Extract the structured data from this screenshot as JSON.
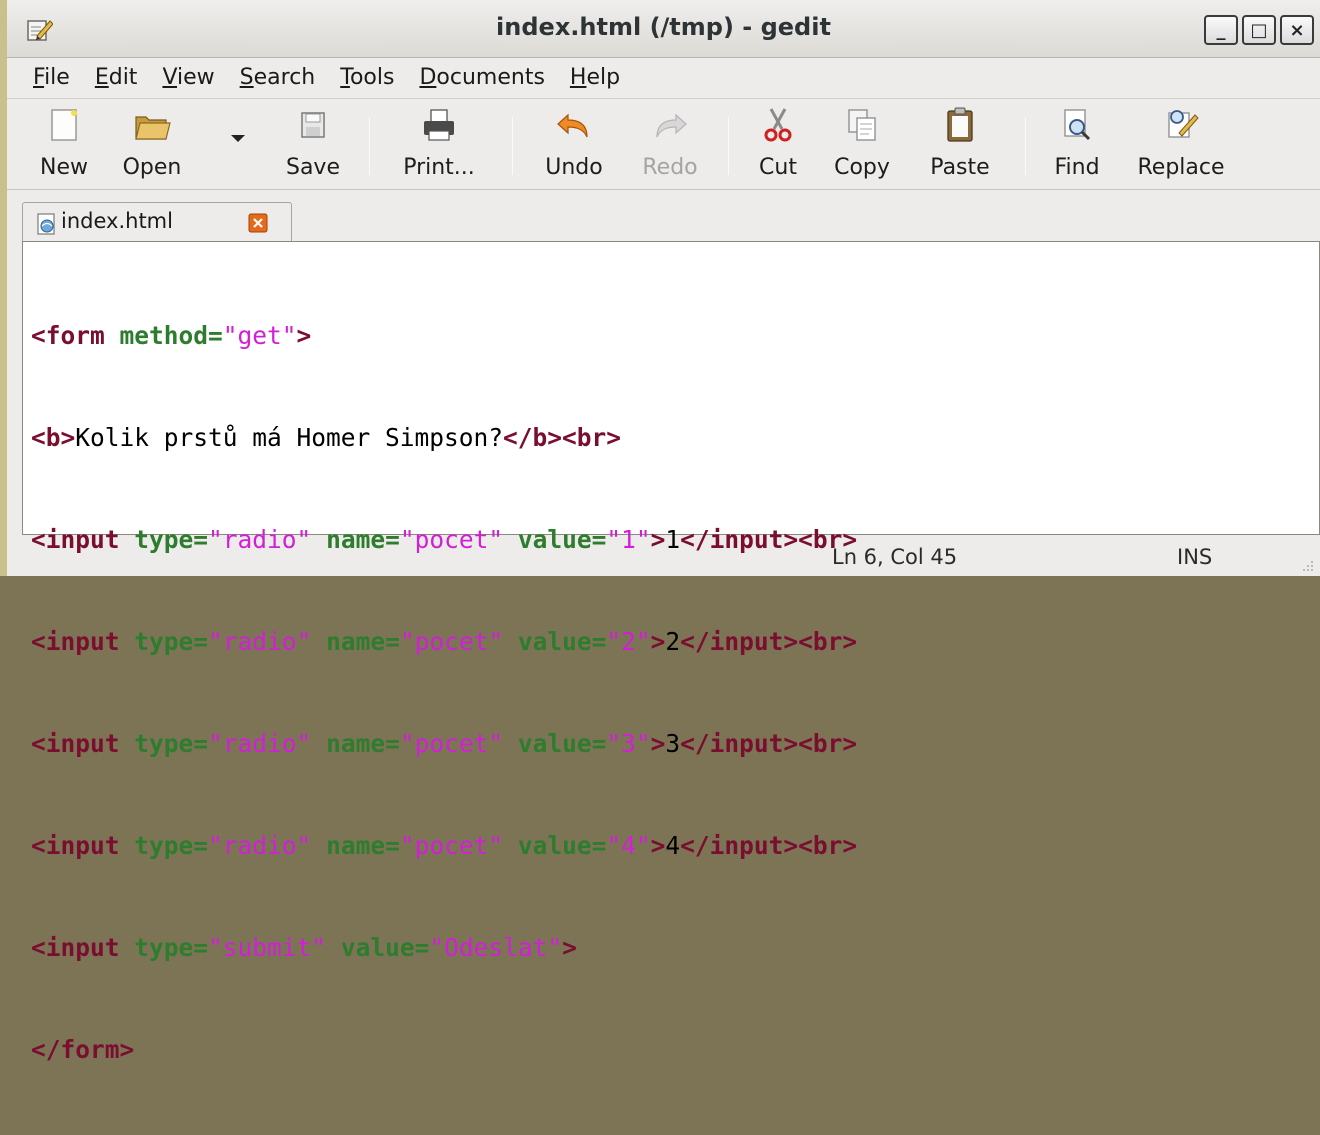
{
  "window": {
    "title": "index.html (/tmp) - gedit",
    "controls": {
      "minimize": "_",
      "maximize": "□",
      "close": "×"
    }
  },
  "menu": [
    {
      "label": "File",
      "mnemonic": "F",
      "rest": "ile"
    },
    {
      "label": "Edit",
      "mnemonic": "E",
      "rest": "dit"
    },
    {
      "label": "View",
      "mnemonic": "V",
      "rest": "iew"
    },
    {
      "label": "Search",
      "mnemonic": "S",
      "rest": "earch"
    },
    {
      "label": "Tools",
      "mnemonic": "T",
      "rest": "ools"
    },
    {
      "label": "Documents",
      "mnemonic": "D",
      "rest": "ocuments"
    },
    {
      "label": "Help",
      "mnemonic": "H",
      "rest": "elp"
    }
  ],
  "toolbar": {
    "new": "New",
    "open": "Open",
    "save": "Save",
    "print": "Print...",
    "undo": "Undo",
    "redo": "Redo",
    "cut": "Cut",
    "copy": "Copy",
    "paste": "Paste",
    "find": "Find",
    "replace": "Replace"
  },
  "tab": {
    "label": "index.html"
  },
  "code": {
    "l1": {
      "t1": "<form ",
      "a1": "method=",
      "s1": "\"get\"",
      "t2": ">"
    },
    "l2": {
      "t1": "<b>",
      "x1": "Kolik prstů má Homer Simpson?",
      "t2": "</b><br>"
    },
    "l3": {
      "t1": "<input ",
      "a1": "type=",
      "s1": "\"radio\"",
      "a2": "name=",
      "s2": "\"pocet\"",
      "a3": "value=",
      "s3": "\"1\"",
      "t2": ">",
      "x1": "1",
      "t3": "</input><br>"
    },
    "l4": {
      "t1": "<input ",
      "a1": "type=",
      "s1": "\"radio\"",
      "a2": "name=",
      "s2": "\"pocet\"",
      "a3": "value=",
      "s3": "\"2\"",
      "t2": ">",
      "x1": "2",
      "t3": "</input><br>"
    },
    "l5": {
      "t1": "<input ",
      "a1": "type=",
      "s1": "\"radio\"",
      "a2": "name=",
      "s2": "\"pocet\"",
      "a3": "value=",
      "s3": "\"3\"",
      "t2": ">",
      "x1": "3",
      "t3": "</input><br>"
    },
    "l6": {
      "t1": "<input ",
      "a1": "type=",
      "s1": "\"radio\"",
      "a2": "name=",
      "s2": "\"pocet\"",
      "a3": "value=",
      "s3": "\"4\"",
      "t2": ">",
      "x1": "4",
      "t3": "</input><br>"
    },
    "l7": {
      "t1": "<input ",
      "a1": "type=",
      "s1": "\"submit\"",
      "a2": "value=",
      "s2": "\"Odeslat\"",
      "t2": ">"
    },
    "l8": {
      "t1": "</form>"
    }
  },
  "status": {
    "position": "Ln 6, Col 45",
    "mode": "INS"
  },
  "colors": {
    "tag": "#7a0e2f",
    "attribute": "#2e7d2e",
    "string": "#d31ed8",
    "text": "#000000"
  },
  "icons": [
    "text-editor-icon",
    "new-document-icon",
    "open-folder-icon",
    "floppy-save-icon",
    "printer-icon",
    "undo-arrow-icon",
    "redo-arrow-icon",
    "scissors-icon",
    "copy-pages-icon",
    "clipboard-icon",
    "magnifier-icon",
    "replace-pencil-icon",
    "html-document-icon",
    "tab-close-icon",
    "resize-grip-icon"
  ]
}
